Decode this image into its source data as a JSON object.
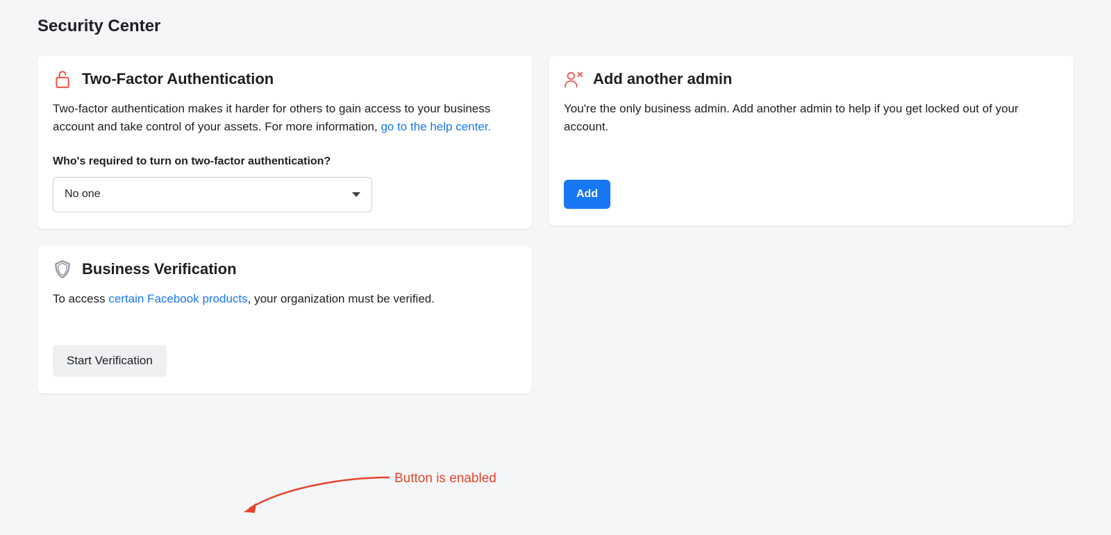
{
  "page": {
    "title": "Security Center"
  },
  "twofa": {
    "title": "Two-Factor Authentication",
    "body_prefix": "Two-factor authentication makes it harder for others to gain access to your business account and take control of your assets. For more information, ",
    "link_text": "go to the help center.",
    "who_label": "Who's required to turn on two-factor authentication?",
    "selected": "No one"
  },
  "verification": {
    "title": "Business Verification",
    "body_prefix": "To access ",
    "link_text": "certain Facebook products",
    "body_suffix": ", your organization must be verified.",
    "button": "Start Verification",
    "annotation": "Button is enabled"
  },
  "admin": {
    "title": "Add another admin",
    "body": "You're the only business admin. Add another admin to help if you get locked out of your account.",
    "button": "Add"
  }
}
